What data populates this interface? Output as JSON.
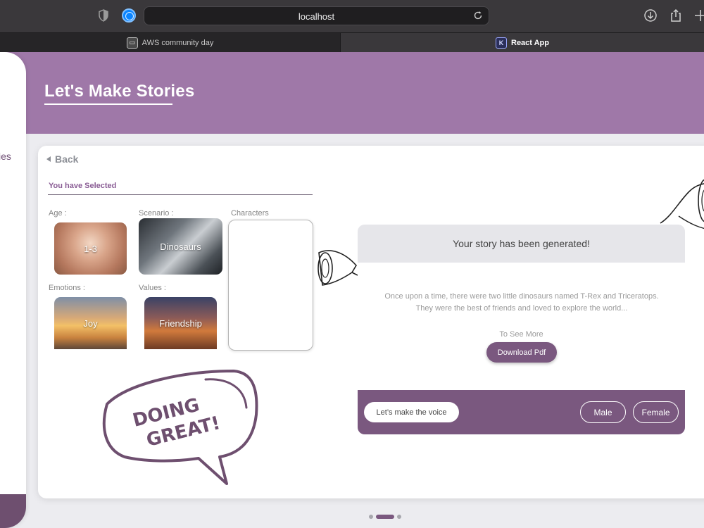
{
  "browser": {
    "url": "localhost",
    "tabs": [
      {
        "label": "AWS community day",
        "active": false
      },
      {
        "label": "React App",
        "active": true
      }
    ]
  },
  "sidebar": {
    "partial_text": "ies"
  },
  "header": {
    "title": "Let's Make Stories"
  },
  "selection": {
    "back_label": "Back",
    "heading": "You have Selected",
    "age": {
      "label": "Age :",
      "value": "1-3"
    },
    "scenario": {
      "label": "Scenario :",
      "value": "Dinosaurs"
    },
    "characters": {
      "label": "Characters"
    },
    "emotions": {
      "label": "Emotions :",
      "value": "Joy"
    },
    "values": {
      "label": "Values :",
      "value": "Friendship"
    }
  },
  "bubble": {
    "line1": "DOING",
    "line2": "GREAT!"
  },
  "story": {
    "heading": "Your story has been generated!",
    "excerpt": "Once upon a time, there were two little dinosaurs named T-Rex and Triceratops. They were the best of friends and loved to explore the world...",
    "see_more": "To See More",
    "download_label": "Download Pdf",
    "voice_label": "Let’s make the voice",
    "male_label": "Male",
    "female_label": "Female"
  },
  "pagination": {
    "count": 3,
    "active": 2
  },
  "colors": {
    "header": "#9f78a8",
    "accent": "#7a587f"
  }
}
